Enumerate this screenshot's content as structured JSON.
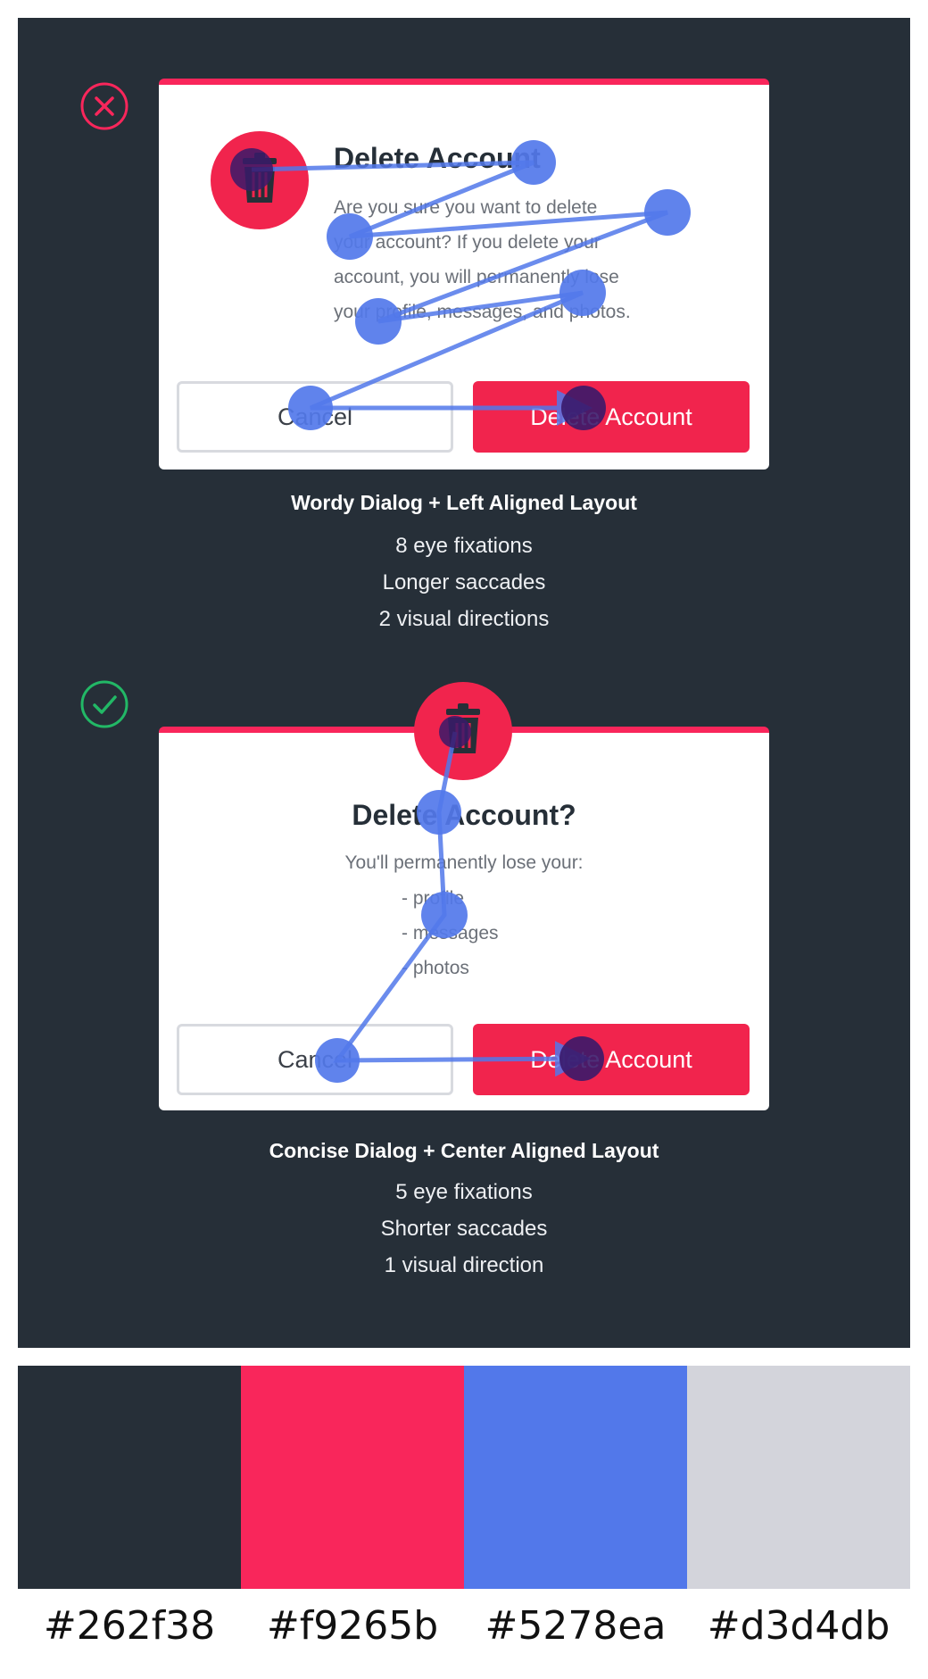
{
  "comparison_bad": {
    "status_icon": "x-circle-icon",
    "icon_name": "trash-icon",
    "title": "Delete Account",
    "body_lines": [
      "Are you sure you want to delete",
      "your account? If you delete your",
      "account, you will permanently lose",
      "your profile, messages, and photos."
    ],
    "cancel_label": "Cancel",
    "delete_label": "Delete Account",
    "caption": {
      "heading": "Wordy Dialog + Left Aligned Layout",
      "lines": [
        "8 eye fixations",
        "Longer saccades",
        "2 visual directions"
      ]
    }
  },
  "comparison_good": {
    "status_icon": "check-circle-icon",
    "icon_name": "trash-icon",
    "title": "Delete Account?",
    "intro": "You'll permanently lose your:",
    "list_items": [
      "- profile",
      "- messages",
      "- photos"
    ],
    "cancel_label": "Cancel",
    "delete_label": "Delete Account",
    "caption": {
      "heading": "Concise Dialog + Center Aligned Layout",
      "lines": [
        "5 eye fixations",
        "Shorter saccades",
        "1 visual direction"
      ]
    }
  },
  "palette": {
    "colors": [
      "#262f38",
      "#f9265b",
      "#5278ea",
      "#d3d4db"
    ],
    "labels": [
      "#262f38",
      "#f9265b",
      "#5278ea",
      "#d3d4db"
    ]
  }
}
